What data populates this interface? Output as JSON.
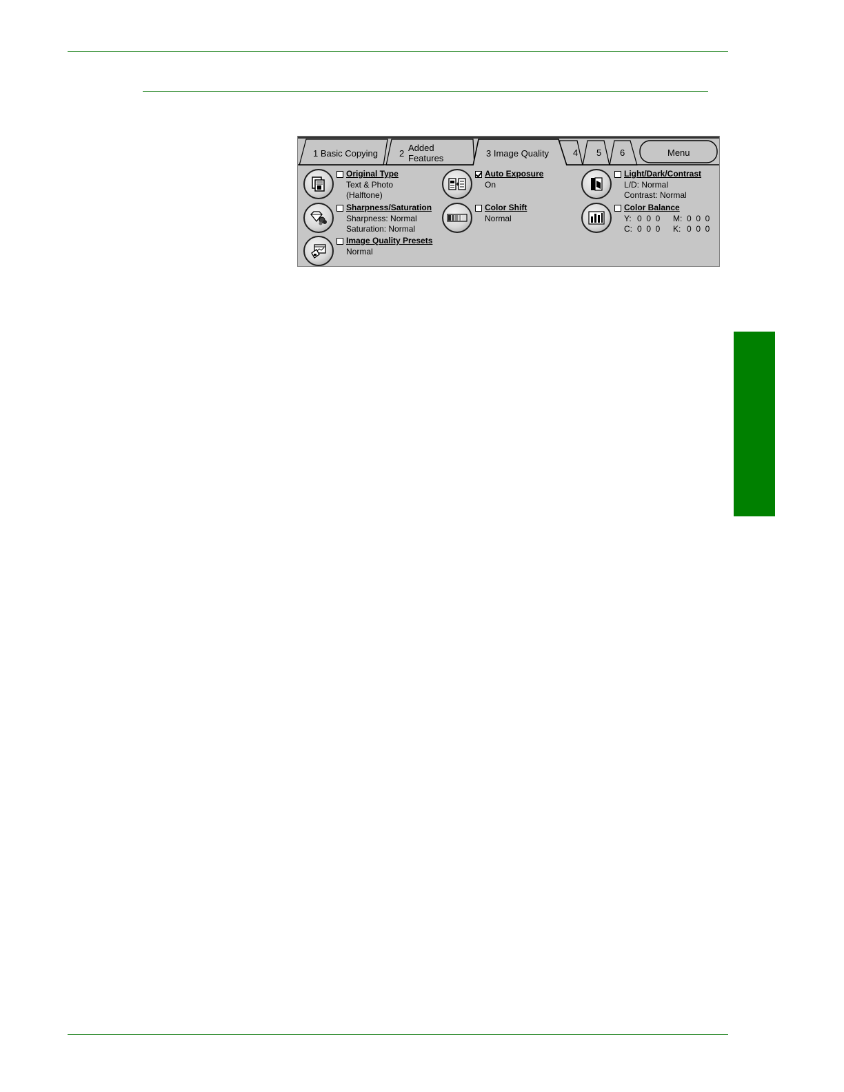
{
  "tabs": [
    {
      "number": "1",
      "label": "Basic Copying"
    },
    {
      "number": "2",
      "label": "Added",
      "label2": "Features"
    },
    {
      "number": "3",
      "label": "Image Quality"
    },
    {
      "number": "4"
    },
    {
      "number": "5"
    },
    {
      "number": "6"
    }
  ],
  "menu_label": "Menu",
  "active_tab": "3",
  "features": {
    "original_type": {
      "title": "Original Type",
      "line1": "Text & Photo",
      "line2": "(Halftone)",
      "checked": false
    },
    "sharpness": {
      "title": "Sharpness/Saturation",
      "line1": "Sharpness: Normal",
      "line2": "Saturation: Normal",
      "checked": false
    },
    "presets": {
      "title": "Image Quality Presets",
      "line1": "Normal",
      "checked": false
    },
    "auto_exposure": {
      "title": "Auto Exposure",
      "line1": "On",
      "checked": true
    },
    "color_shift": {
      "title": "Color Shift",
      "line1": "Normal",
      "checked": false
    },
    "light_dark": {
      "title": "Light/Dark/Contrast",
      "line1": "L/D: Normal",
      "line2": "Contrast: Normal",
      "checked": false
    },
    "color_balance": {
      "title": "Color Balance",
      "checked": false,
      "y_label": "Y:",
      "y_values": "0  0  0",
      "m_label": "M:",
      "m_values": "0  0  0",
      "c_label": "C:",
      "c_values": "0  0  0",
      "k_label": "K:",
      "k_values": "0  0  0"
    }
  },
  "colors": {
    "accent": "#008000",
    "rule": "#2e8b2e",
    "panel": "#c6c6c6"
  },
  "icons": [
    "original-type-icon",
    "sharpness-saturation-icon",
    "image-quality-presets-icon",
    "auto-exposure-icon",
    "color-shift-icon",
    "light-dark-contrast-icon",
    "color-balance-icon"
  ]
}
